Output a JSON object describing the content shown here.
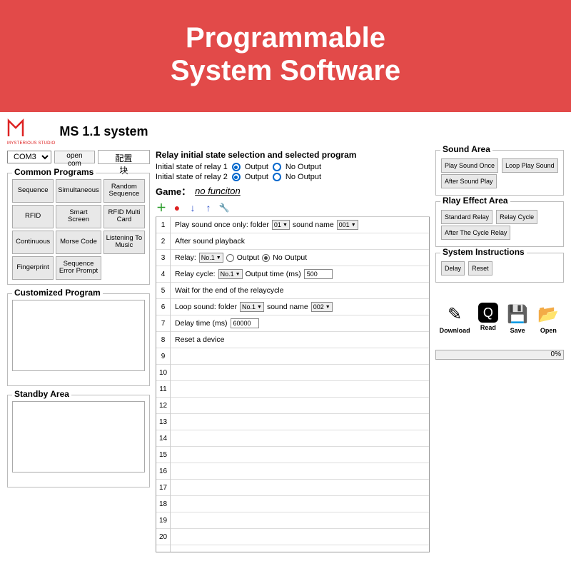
{
  "banner": {
    "line1": "Programmable",
    "line2": "System Software"
  },
  "title": "MS 1.1 system",
  "logo_sub": "MYSTERIOUS STUDIO",
  "com": {
    "port": "COM3",
    "open": "open com",
    "config": "配置块"
  },
  "common": {
    "title": "Common Programs",
    "items": [
      "Sequence",
      "Simultaneous",
      "Random Sequence",
      "RFID",
      "Smart Screen",
      "RFID Multi Card",
      "Continuous",
      "Morse Code",
      "Listening To Music",
      "Fingerprint",
      "Sequence Error Prompt",
      ""
    ]
  },
  "custom": {
    "title": "Customized Program"
  },
  "standby": {
    "title": "Standby Area"
  },
  "relay": {
    "header": "Relay initial state selection and selected program",
    "row1": "Initial state of relay 1",
    "row2": "Initial state of relay 2",
    "opt_output": "Output",
    "opt_no_output": "No Output",
    "game_label": "Game：",
    "game_value": "no funciton"
  },
  "steps": {
    "r1": {
      "text": "Play sound once only: folder",
      "sel1": "01",
      "mid": "sound name",
      "sel2": "001"
    },
    "r2": "After sound playback",
    "r3": {
      "label": "Relay:",
      "sel": "No.1",
      "opt1": "Output",
      "opt2": "No Output"
    },
    "r4": {
      "label": "Relay cycle:",
      "sel": "No.1",
      "mid": "Output time (ms)",
      "val": "500"
    },
    "r5": "Wait for the end of the relaycycle",
    "r6": {
      "label": "Loop sound: folder",
      "sel1": "No.1",
      "mid": "sound name",
      "sel2": "002"
    },
    "r7": {
      "label": "Delay time (ms)",
      "val": "60000"
    },
    "r8": "Reset a device"
  },
  "sound": {
    "title": "Sound Area",
    "b1": "Play Sound Once",
    "b2": "Loop Play Sound",
    "b3": "After Sound Play"
  },
  "relay_effect": {
    "title": "Rlay Effect Area",
    "b1": "Standard Relay",
    "b2": "Relay Cycle",
    "b3": "After The Cycle Relay"
  },
  "sys": {
    "title": "System Instructions",
    "b1": "Delay",
    "b2": "Reset"
  },
  "actions": {
    "download": "Download",
    "read": "Read",
    "save": "Save",
    "open": "Open"
  },
  "progress": "0%"
}
